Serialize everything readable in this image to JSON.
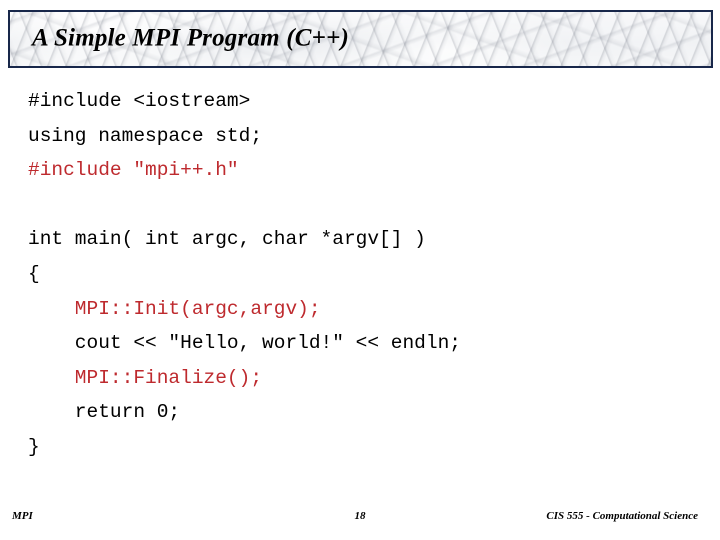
{
  "slide": {
    "title": "A Simple MPI Program (C++)",
    "accent_red": "#be2a2e",
    "title_border_color": "#18274a",
    "background_color": "#ffffff"
  },
  "code": {
    "lines": [
      {
        "text": "#include <iostream>",
        "color": "black"
      },
      {
        "text": "using namespace std;",
        "color": "black"
      },
      {
        "text": "#include \"mpi++.h\"",
        "color": "red"
      },
      {
        "text": "",
        "color": "black"
      },
      {
        "text": "int main( int argc, char *argv[] )",
        "color": "black"
      },
      {
        "text": "{",
        "color": "black"
      },
      {
        "text": "    MPI::Init(argc,argv);",
        "color": "red"
      },
      {
        "text": "    cout << \"Hello, world!\" << endln;",
        "color": "black"
      },
      {
        "text": "    MPI::Finalize();",
        "color": "red"
      },
      {
        "text": "    return 0;",
        "color": "black"
      },
      {
        "text": "}",
        "color": "black"
      }
    ]
  },
  "footer": {
    "left": "MPI",
    "page_number": "18",
    "right": "CIS 555 - Computational Science"
  }
}
